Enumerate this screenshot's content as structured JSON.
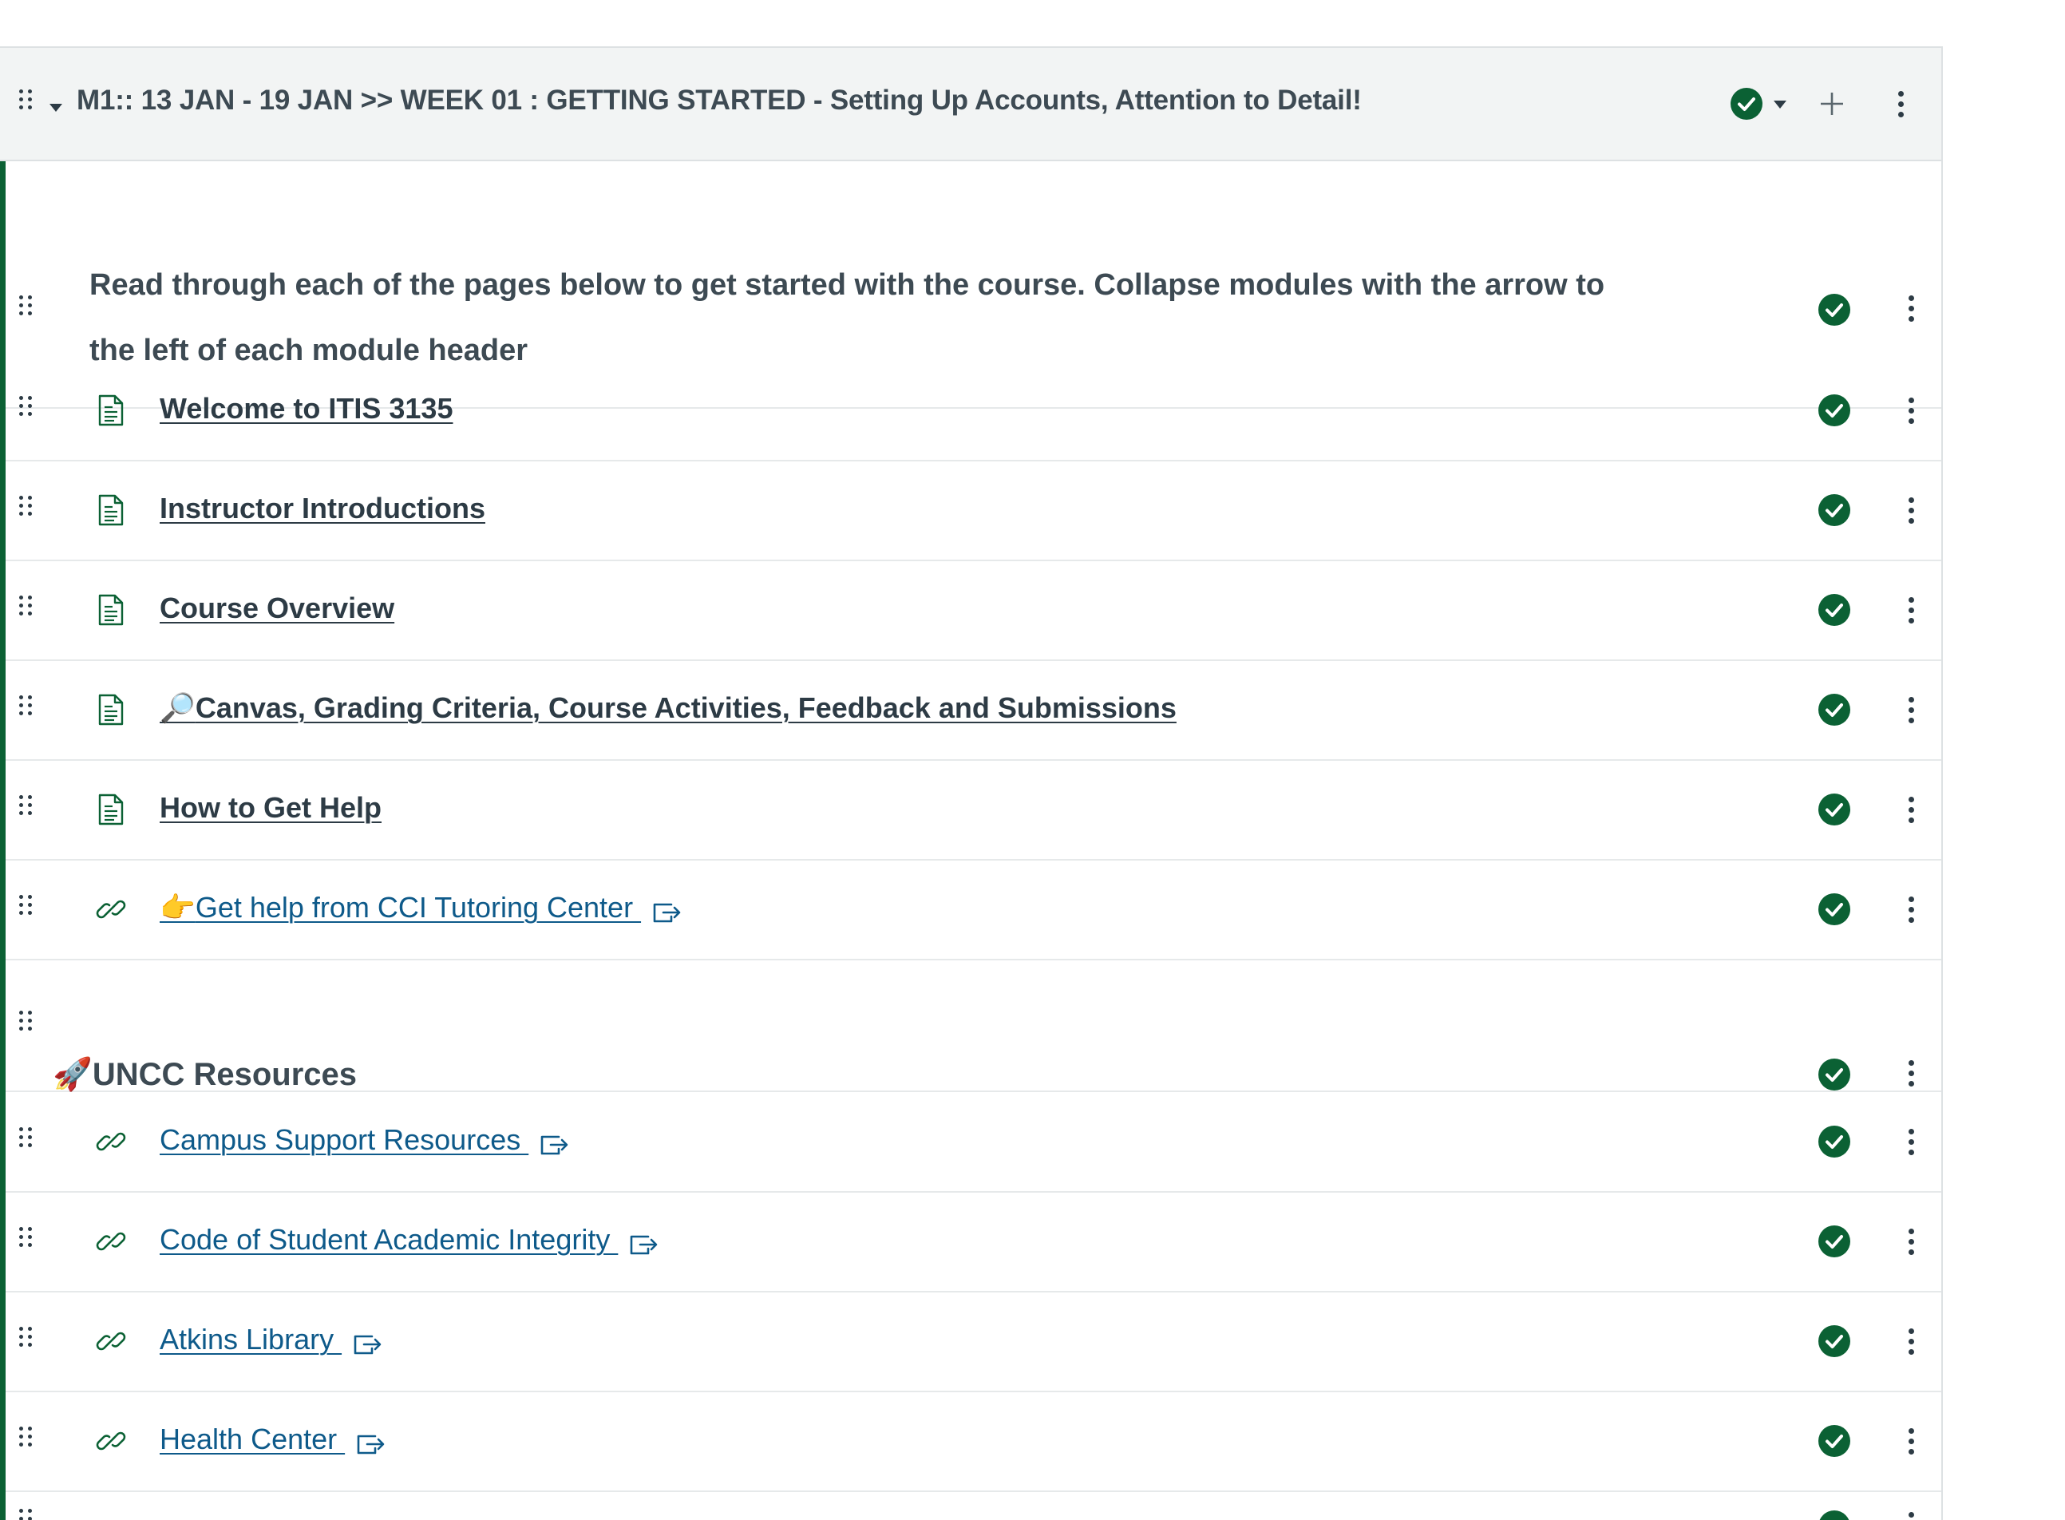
{
  "colors": {
    "accent_green": "#0b6134",
    "text_dark": "#2d3b45",
    "link_blue": "#0e5a8a",
    "header_bg": "#f2f4f4"
  },
  "module": {
    "title": "M1:: 13 JAN - 19 JAN >> WEEK 01 : GETTING STARTED - Setting Up Accounts, Attention to Detail!",
    "status_icon": "published-check-icon",
    "actions": [
      "caret-down-icon",
      "plus-icon",
      "kebab-menu-icon"
    ]
  },
  "intro": {
    "text": "Read through each of the pages below to get started with the course. Collapse modules with the arrow to the left of each module header"
  },
  "items": [
    {
      "type": "page",
      "icon": "document-icon",
      "label": "Welcome to ITIS 3135"
    },
    {
      "type": "page",
      "icon": "document-icon",
      "label": "Instructor Introductions"
    },
    {
      "type": "page",
      "icon": "document-icon",
      "label": "Course Overview"
    },
    {
      "type": "page",
      "icon": "document-icon",
      "emoji": "🔎",
      "label": "Canvas, Grading Criteria, Course Activities, Feedback and Submissions"
    },
    {
      "type": "page",
      "icon": "document-icon",
      "label": "How to Get Help"
    },
    {
      "type": "external",
      "icon": "link-icon",
      "emoji": "👉",
      "label": "Get help from CCI Tutoring Center "
    }
  ],
  "subheader": {
    "emoji": "🚀",
    "label": "UNCC Resources"
  },
  "resources": [
    {
      "type": "external",
      "icon": "link-icon",
      "label": "Campus Support Resources "
    },
    {
      "type": "external",
      "icon": "link-icon",
      "label": "Code of Student Academic Integrity "
    },
    {
      "type": "external",
      "icon": "link-icon",
      "label": "Atkins Library "
    },
    {
      "type": "external",
      "icon": "link-icon",
      "label": "Health Center "
    }
  ]
}
